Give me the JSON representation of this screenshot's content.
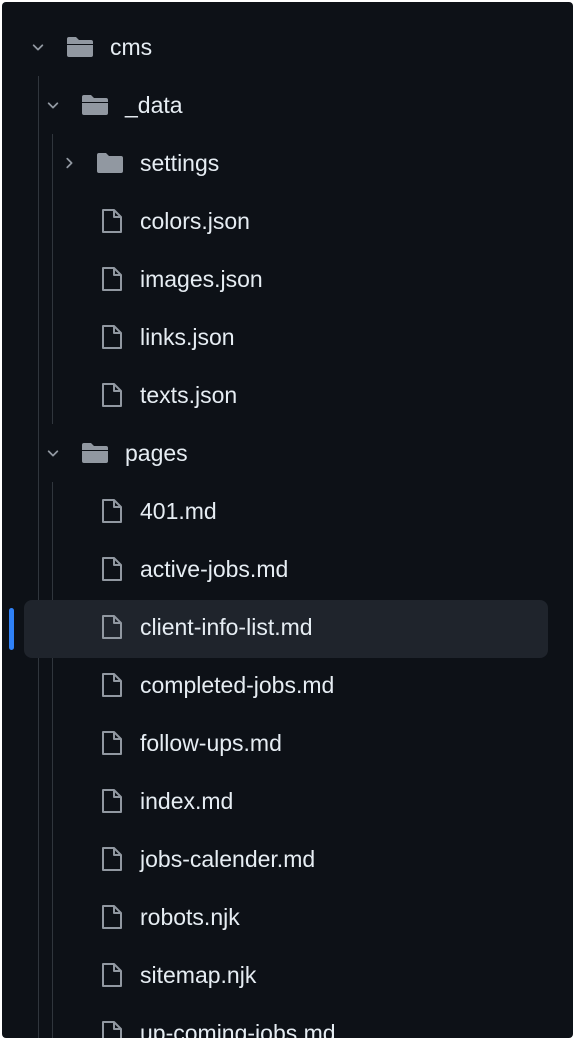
{
  "theme": {
    "background": "#0d1117",
    "text": "#e6edf3",
    "icon": "#9198a1",
    "selected_row": "#1f242c",
    "active_indicator": "#2f81f7",
    "guide_line": "#30363d"
  },
  "tree": {
    "root": {
      "name": "cms",
      "icon": "folder-open-icon",
      "expanded": true
    },
    "data_folder": {
      "name": "_data",
      "icon": "folder-open-icon",
      "expanded": true
    },
    "settings_folder": {
      "name": "settings",
      "icon": "folder-icon",
      "expanded": false
    },
    "data_files": [
      "colors.json",
      "images.json",
      "links.json",
      "texts.json"
    ],
    "pages_folder": {
      "name": "pages",
      "icon": "folder-open-icon",
      "expanded": true
    },
    "page_files": [
      "401.md",
      "active-jobs.md",
      "client-info-list.md",
      "completed-jobs.md",
      "follow-ups.md",
      "index.md",
      "jobs-calender.md",
      "robots.njk",
      "sitemap.njk",
      "up-coming-jobs.md"
    ],
    "selected_file": "client-info-list.md"
  }
}
